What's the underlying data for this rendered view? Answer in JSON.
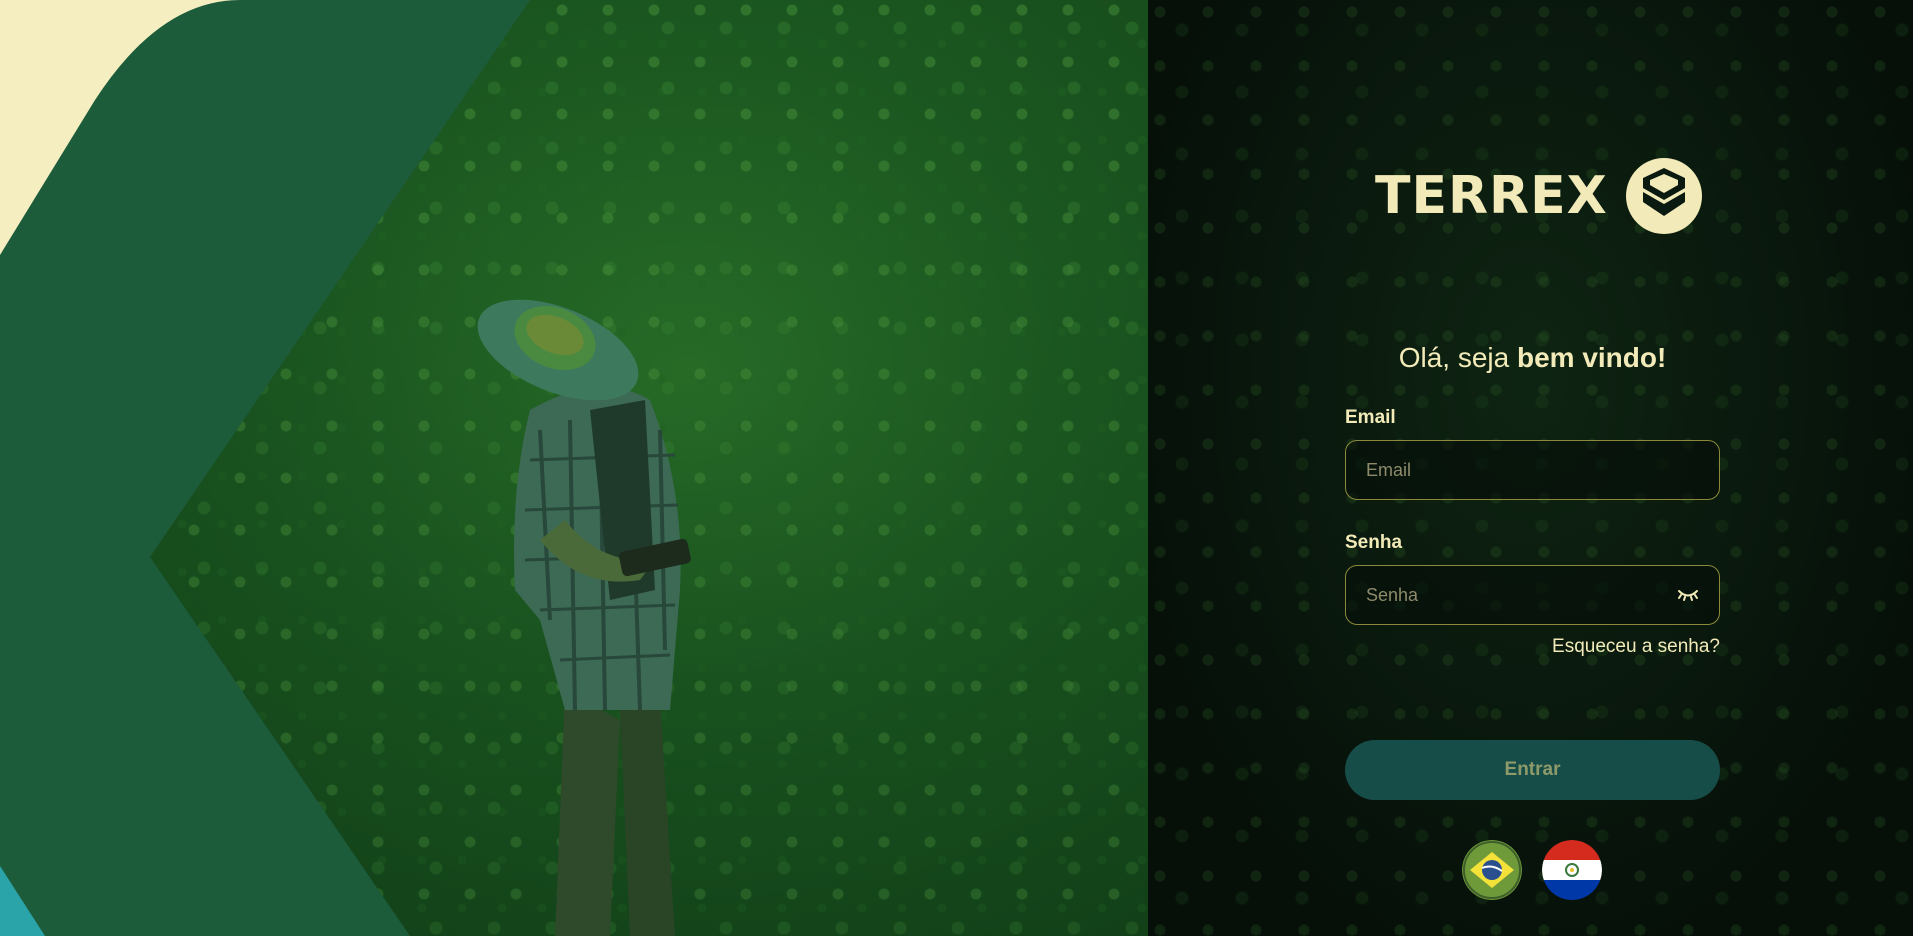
{
  "brand": {
    "name": "TERREX",
    "logo_icon": "terrex-shield-chevron-icon",
    "color": "#f2ebb9"
  },
  "welcome": {
    "greeting": "Olá, seja ",
    "emphasis": "bem vindo!"
  },
  "form": {
    "email_label": "Email",
    "email_placeholder": "Email",
    "email_value": "",
    "password_label": "Senha",
    "password_placeholder": "Senha",
    "password_value": "",
    "toggle_icon": "eye-closed-icon",
    "forgot_link": "Esqueceu a senha?",
    "submit_label": "Entrar"
  },
  "languages": [
    {
      "name": "brazil-flag-icon"
    },
    {
      "name": "paraguay-flag-icon"
    }
  ],
  "colors": {
    "accent_text": "#f2ebb9",
    "field_border": "#8c8a3a",
    "button_bg": "#174d48",
    "button_text": "#8e9a6a",
    "decor_dark_green": "#1c5c3b",
    "decor_cream": "#f5eec1",
    "decor_teal": "#2aa3a9"
  }
}
